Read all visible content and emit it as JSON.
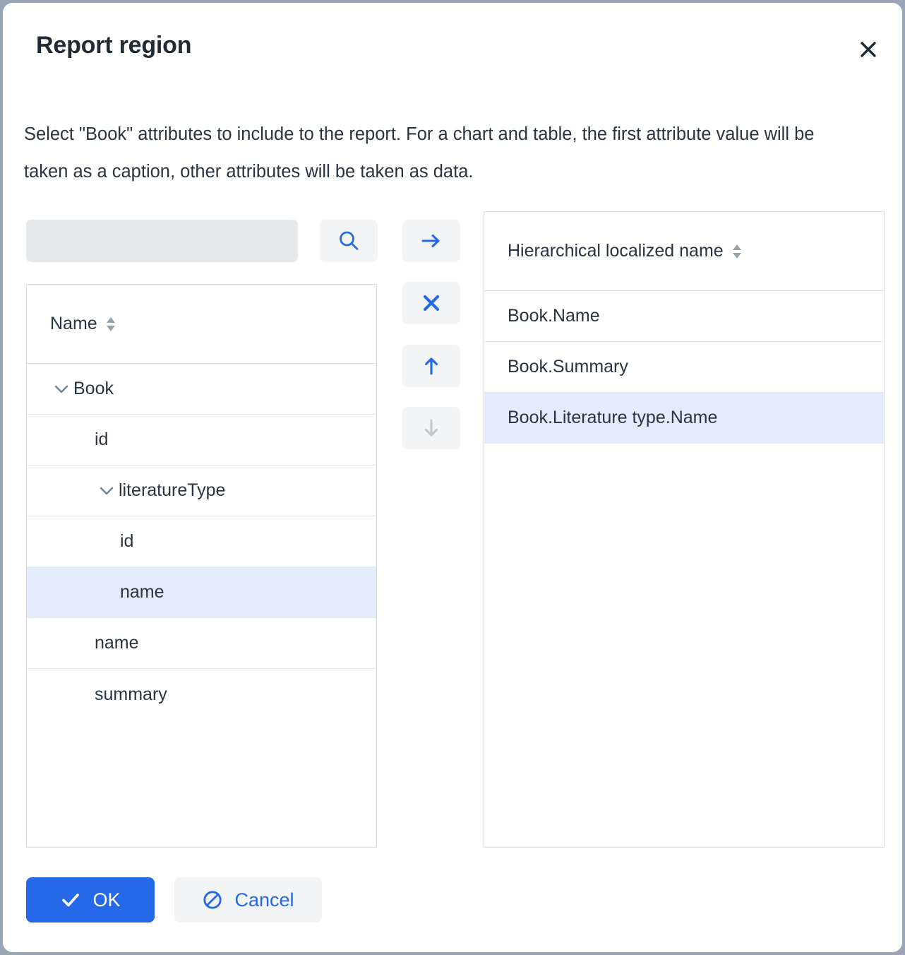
{
  "dialog": {
    "title": "Report region",
    "close_label": "×",
    "description": "Select \"Book\" attributes to include to the report. For a chart and table, the first attribute value will be taken as a caption, other attributes will be taken as data."
  },
  "search": {
    "value": "",
    "placeholder": "",
    "button_icon": "search-icon"
  },
  "actions": [
    {
      "name": "add-attribute-button",
      "icon": "arrow-right-icon",
      "enabled": true,
      "color": "#2568e8"
    },
    {
      "name": "remove-attribute-button",
      "icon": "close-x-icon",
      "enabled": true,
      "color": "#2568e8"
    },
    {
      "name": "move-up-button",
      "icon": "arrow-up-icon",
      "enabled": true,
      "color": "#2568e8"
    },
    {
      "name": "move-down-button",
      "icon": "arrow-down-icon",
      "enabled": false,
      "color": "#c0c7cf"
    }
  ],
  "left_panel": {
    "column_header": "Name",
    "sort_icon": "sort-both-icon",
    "rows": [
      {
        "label": "Book",
        "level": 0,
        "chevron": "chevron-down-icon",
        "selected": false,
        "last": false
      },
      {
        "label": "id",
        "level": 1,
        "chevron": "",
        "selected": false,
        "last": false
      },
      {
        "label": "literatureType",
        "level": 1,
        "chevron": "chevron-down-icon",
        "selected": false,
        "last": false
      },
      {
        "label": "id",
        "level": 2,
        "chevron": "",
        "selected": false,
        "last": false
      },
      {
        "label": "name",
        "level": 2,
        "chevron": "",
        "selected": true,
        "last": false
      },
      {
        "label": "name",
        "level": 1,
        "chevron": "",
        "selected": false,
        "last": false
      },
      {
        "label": "summary",
        "level": 1,
        "chevron": "",
        "selected": false,
        "last": true
      }
    ]
  },
  "right_panel": {
    "column_header": "Hierarchical localized name",
    "sort_icon": "sort-both-icon",
    "rows": [
      {
        "label": "Book.Name",
        "selected": false
      },
      {
        "label": "Book.Summary",
        "selected": false
      },
      {
        "label": "Book.Literature type.Name",
        "selected": true
      }
    ]
  },
  "footer": {
    "ok_label": "OK",
    "ok_icon": "check-icon",
    "cancel_label": "Cancel",
    "cancel_icon": "ban-icon"
  },
  "colors": {
    "accent": "#2568e8",
    "selection": "#e3ecfa",
    "text": "#2a3342",
    "title": "#212b36",
    "border": "#d8dde3",
    "input_bg": "#e5e9ec",
    "button_bg": "#f2f4f6",
    "disabled": "#c0c7cf",
    "backdrop": "#9aa5b5"
  }
}
